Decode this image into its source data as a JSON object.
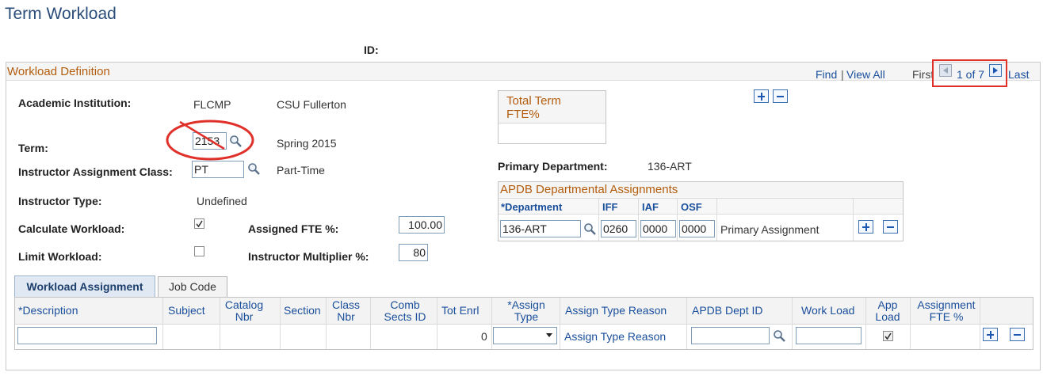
{
  "page_title": "Term Workload",
  "id_label": "ID:",
  "section": {
    "title": "Workload Definition",
    "find": "Find",
    "sep": "|",
    "view_all": "View All",
    "first": "First",
    "counter": "1 of 7",
    "last": "Last"
  },
  "fields": {
    "academic_institution": {
      "label": "Academic Institution:",
      "code": "FLCMP",
      "name": "CSU Fullerton"
    },
    "term": {
      "label": "Term:",
      "value": "2153",
      "desc": "Spring 2015"
    },
    "instructor_assignment_class": {
      "label": "Instructor Assignment Class:",
      "value": "PT",
      "desc": "Part-Time"
    },
    "instructor_type": {
      "label": "Instructor Type:",
      "value": "Undefined"
    },
    "calculate_workload": {
      "label": "Calculate Workload:",
      "checked": true
    },
    "limit_workload": {
      "label": "Limit Workload:",
      "checked": false
    },
    "assigned_fte": {
      "label": "Assigned FTE %:",
      "value": "100.00"
    },
    "instructor_multiplier": {
      "label": "Instructor Multiplier %:",
      "value": "80"
    }
  },
  "total_term_fte": {
    "title": "Total Term FTE%"
  },
  "primary_department": {
    "label": "Primary Department:",
    "value": "136-ART"
  },
  "apdb": {
    "title": "APDB Departmental Assignments",
    "columns": [
      "*Department",
      "IFF",
      "IAF",
      "OSF"
    ],
    "row": {
      "department": "136-ART",
      "iff": "0260",
      "iaf": "0000",
      "osf": "0000",
      "desc": "Primary Assignment"
    }
  },
  "tabs": [
    "Workload Assignment",
    "Job Code"
  ],
  "workload_grid": {
    "columns": {
      "description": "*Description",
      "subject": "Subject",
      "catalog_nbr": "Catalog Nbr",
      "section": "Section",
      "class_nbr": "Class Nbr",
      "comb_sects_id": "Comb Sects ID",
      "tot_enrl": "Tot Enrl",
      "assign_type": "*Assign Type",
      "assign_type_reason": "Assign Type Reason",
      "apdb_dept_id": "APDB Dept ID",
      "work_load": "Work Load",
      "app_load": "App Load",
      "assignment_fte": "Assignment FTE %"
    },
    "row": {
      "description": "",
      "tot_enrl": "0",
      "assign_type": "",
      "assign_type_reason": "Assign Type Reason",
      "apdb_dept_id": "",
      "work_load": "",
      "app_load": true
    }
  },
  "colors": {
    "title": "#2b4d7a",
    "section_title": "#b35c0c",
    "link": "#1a4f9c",
    "highlight": "#e0302a"
  }
}
